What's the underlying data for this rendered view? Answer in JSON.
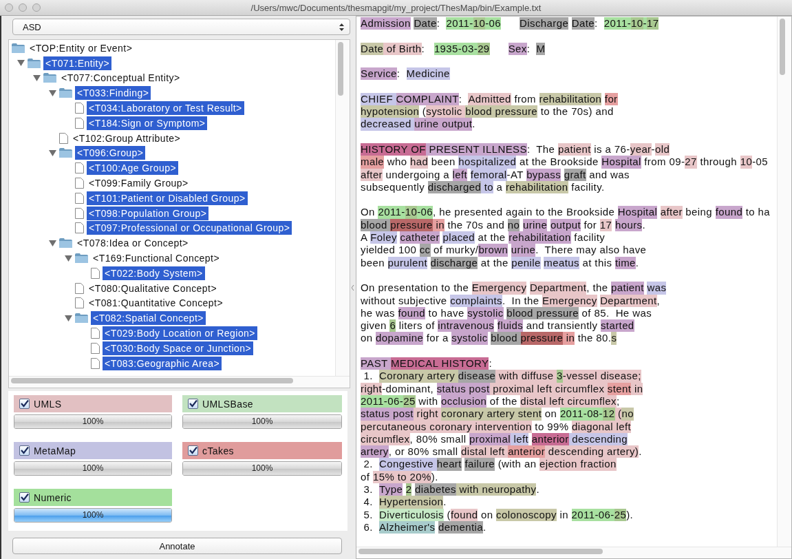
{
  "window": {
    "title": "/Users/mwc/Documents/thesmapgit/my_project/ThesMap/bin/Example.txt"
  },
  "left": {
    "dropdown": {
      "value": "ASD"
    },
    "tree": [
      {
        "label": "<TOP:Entity or Event>",
        "kind": "folder",
        "selected": false,
        "children": [
          {
            "label": "<T071:Entity>",
            "kind": "folder",
            "selected": true,
            "expanded": true,
            "children": [
              {
                "label": "<T077:Conceptual Entity>",
                "kind": "folder",
                "selected": false,
                "expanded": true,
                "children": [
                  {
                    "label": "<T033:Finding>",
                    "kind": "folder",
                    "selected": true,
                    "expanded": true,
                    "children": [
                      {
                        "label": "<T034:Laboratory or Test Result>",
                        "kind": "file",
                        "selected": true
                      },
                      {
                        "label": "<T184:Sign or Symptom>",
                        "kind": "file",
                        "selected": true
                      }
                    ]
                  },
                  {
                    "label": "<T102:Group Attribute>",
                    "kind": "file",
                    "selected": false
                  },
                  {
                    "label": "<T096:Group>",
                    "kind": "folder",
                    "selected": true,
                    "expanded": true,
                    "children": [
                      {
                        "label": "<T100:Age Group>",
                        "kind": "file",
                        "selected": true
                      },
                      {
                        "label": "<T099:Family Group>",
                        "kind": "file",
                        "selected": false
                      },
                      {
                        "label": "<T101:Patient or Disabled Group>",
                        "kind": "file",
                        "selected": true
                      },
                      {
                        "label": "<T098:Population Group>",
                        "kind": "file",
                        "selected": true
                      },
                      {
                        "label": "<T097:Professional or Occupational Group>",
                        "kind": "file",
                        "selected": true
                      }
                    ]
                  },
                  {
                    "label": "<T078:Idea or Concept>",
                    "kind": "folder",
                    "selected": false,
                    "expanded": true,
                    "children": [
                      {
                        "label": "<T169:Functional Concept>",
                        "kind": "folder",
                        "selected": false,
                        "expanded": true,
                        "children": [
                          {
                            "label": "<T022:Body System>",
                            "kind": "file",
                            "selected": true
                          }
                        ]
                      },
                      {
                        "label": "<T080:Qualitative Concept>",
                        "kind": "file",
                        "selected": false
                      },
                      {
                        "label": "<T081:Quantitative Concept>",
                        "kind": "file",
                        "selected": false
                      },
                      {
                        "label": "<T082:Spatial Concept>",
                        "kind": "folder",
                        "selected": true,
                        "expanded": true,
                        "children": [
                          {
                            "label": "<T029:Body Location or Region>",
                            "kind": "file",
                            "selected": true
                          },
                          {
                            "label": "<T030:Body Space or Junction>",
                            "kind": "file",
                            "selected": true
                          },
                          {
                            "label": "<T083:Geographic Area>",
                            "kind": "file",
                            "selected": true
                          }
                        ]
                      }
                    ]
                  }
                ]
              }
            ]
          }
        ]
      }
    ],
    "sources": [
      {
        "label": "UMLS",
        "checked": true,
        "color": "#e2c0c2",
        "level": 1,
        "reading": "100%",
        "active": false
      },
      {
        "label": "UMLSBase",
        "checked": true,
        "color": "#c2e2c0",
        "level": 1,
        "reading": "100%",
        "active": false
      },
      {
        "label": "MetaMap",
        "checked": true,
        "color": "#c2c2e2",
        "level": 1,
        "reading": "100%",
        "active": false
      },
      {
        "label": "cTakes",
        "checked": true,
        "color": "#e09c9c",
        "level": 1,
        "reading": "100%",
        "active": false
      },
      {
        "label": "Numeric",
        "checked": true,
        "color": "#a4e09c",
        "level": 1,
        "reading": "100%",
        "active": true
      }
    ],
    "annotate_button": "Annotate"
  },
  "document": {
    "paragraphs": [
      {
        "lines": [
          {
            "segments": [
              {
                "text": "Admission",
                "color": "#c8a6cc",
                "space_after": true
              },
              {
                "text": "Date",
                "color": "#a6a6a6"
              },
              {
                "text": ":  "
              },
              {
                "text": "2011-",
                "color": "#a8e0a0"
              },
              {
                "text": "10",
                "color": "#a8c890"
              },
              {
                "text": "-06",
                "color": "#a8e0a0",
                "tab_after": true
              },
              {
                "text": "Discharge",
                "color": "#a6a6a6",
                "space_after": true
              },
              {
                "text": "Date",
                "color": "#a6a6a6"
              },
              {
                "text": ":  "
              },
              {
                "text": "2011-",
                "color": "#a8e0a0"
              },
              {
                "text": "10",
                "color": "#a8c890"
              },
              {
                "text": "-",
                "color": "#a8e0a0"
              },
              {
                "text": "17",
                "color": "#a8c890"
              }
            ]
          }
        ]
      },
      {
        "lines": [
          {
            "segments": [
              {
                "text": "Date",
                "color": "#c8c8a8"
              },
              {
                "text": " of Birth",
                "color": "#e8c6c8"
              },
              {
                "text": ":   "
              },
              {
                "text": "1935-03-",
                "color": "#a8e0a0"
              },
              {
                "text": "29",
                "color": "#a8c890",
                "tab_after": true
              },
              {
                "text": "Sex",
                "color": "#c8a6cc"
              },
              {
                "text": ":  "
              },
              {
                "text": "M",
                "color": "#a6a6a6"
              }
            ]
          }
        ]
      },
      {
        "lines": [
          {
            "segments": [
              {
                "text": "Service",
                "color": "#c8a6cc"
              },
              {
                "text": ":  "
              },
              {
                "text": "Medicine",
                "color": "#c6c6e8"
              }
            ]
          }
        ]
      },
      {
        "lines": [
          {
            "segments": [
              {
                "text": "CHIEF ",
                "color": "#c6c6e8"
              },
              {
                "text": "COMPLAINT",
                "color": "#c8a6cc"
              },
              {
                "text": ":  "
              },
              {
                "text": "Admitted",
                "color": "#e8c6c8"
              },
              {
                "text": " from "
              },
              {
                "text": "rehabilitation",
                "color": "#c8c8a8",
                "space_after": true
              },
              {
                "text": "for",
                "color": "#e6a0a0"
              }
            ]
          },
          {
            "segments": [
              {
                "text": "hypotension",
                "color": "#c8c8a8"
              },
              {
                "text": " ("
              },
              {
                "text": "systolic ",
                "color": "#e8c6c8"
              },
              {
                "text": "blood pressure",
                "color": "#c8c8a8"
              },
              {
                "text": " to the 70s) and"
              }
            ]
          },
          {
            "segments": [
              {
                "text": "decreased ",
                "color": "#c6c6e8"
              },
              {
                "text": "urine output",
                "color": "#c8a6cc"
              },
              {
                "text": "."
              }
            ]
          }
        ]
      },
      {
        "lines": [
          {
            "segments": [
              {
                "text": "HISTORY OF",
                "color": "#c86c94"
              },
              {
                "text": " PRESENT ILLNESS",
                "color": "#c8a6cc"
              },
              {
                "text": ":  The "
              },
              {
                "text": "patient",
                "color": "#e8c6c8"
              },
              {
                "text": " is a 76-"
              },
              {
                "text": "year",
                "color": "#e8c6c8"
              },
              {
                "text": "-"
              },
              {
                "text": "old",
                "color": "#e8c6c8"
              }
            ]
          },
          {
            "segments": [
              {
                "text": "male",
                "color": "#e6a0a0"
              },
              {
                "text": " who "
              },
              {
                "text": "had",
                "color": "#e8c6c8"
              },
              {
                "text": " been "
              },
              {
                "text": "hospitalized",
                "color": "#c6c6e8"
              },
              {
                "text": " at the Brookside "
              },
              {
                "text": "Hospital",
                "color": "#c8a6cc"
              },
              {
                "text": " from 09-"
              },
              {
                "text": "27",
                "color": "#e8c6c8"
              },
              {
                "text": " through "
              },
              {
                "text": "10",
                "color": "#e8c6c8"
              },
              {
                "text": "-05"
              }
            ]
          },
          {
            "segments": [
              {
                "text": "after",
                "color": "#e8c6c8"
              },
              {
                "text": " undergoing a "
              },
              {
                "text": "left",
                "color": "#c8a6cc",
                "space_after": true
              },
              {
                "text": "femoral",
                "color": "#c6c6e8"
              },
              {
                "text": "-AT "
              },
              {
                "text": "bypass",
                "color": "#c8a6cc",
                "space_after": true
              },
              {
                "text": "graft",
                "color": "#a6a6a6"
              },
              {
                "text": " and was"
              }
            ]
          },
          {
            "segments": [
              {
                "text": "subsequently "
              },
              {
                "text": "discharged",
                "color": "#a6a6a6"
              },
              {
                "text": " to",
                "color": "#c6c6e8"
              },
              {
                "text": " a "
              },
              {
                "text": "rehabilitation",
                "color": "#c8c8a8"
              },
              {
                "text": " facility."
              }
            ]
          }
        ]
      },
      {
        "lines": [
          {
            "segments": [
              {
                "text": "On "
              },
              {
                "text": "2011-",
                "color": "#a8e0a0"
              },
              {
                "text": "10",
                "color": "#a8c890"
              },
              {
                "text": "-06",
                "color": "#a8e0a0"
              },
              {
                "text": ", he presented again to the Brookside "
              },
              {
                "text": "Hospital",
                "color": "#c8a6cc",
                "space_after": true
              },
              {
                "text": "after",
                "color": "#e8c6c8"
              },
              {
                "text": " being "
              },
              {
                "text": "found",
                "color": "#c8a6cc"
              },
              {
                "text": " to ha"
              }
            ]
          },
          {
            "segments": [
              {
                "text": "blood ",
                "color": "#a6a6a6"
              },
              {
                "text": "pressure",
                "color": "#b86868"
              },
              {
                "text": " in",
                "color": "#e6a0a0"
              },
              {
                "text": " the 70s and "
              },
              {
                "text": "no",
                "color": "#a6a6a6",
                "space_after": true
              },
              {
                "text": "urine",
                "color": "#c8a6cc",
                "space_after": true
              },
              {
                "text": "output",
                "color": "#c8a6cc"
              },
              {
                "text": " for "
              },
              {
                "text": "17",
                "color": "#e8c6c8",
                "space_after": true
              },
              {
                "text": "hours",
                "color": "#c8a6cc"
              },
              {
                "text": "."
              }
            ]
          },
          {
            "segments": [
              {
                "text": "A "
              },
              {
                "text": "Foley",
                "color": "#c6c6e8",
                "space_after": true
              },
              {
                "text": "catheter",
                "color": "#c8a6cc",
                "space_after": true
              },
              {
                "text": "placed",
                "color": "#c6c6e8"
              },
              {
                "text": " at the "
              },
              {
                "text": "rehabilitation",
                "color": "#c8a6cc"
              },
              {
                "text": " facility"
              }
            ]
          },
          {
            "segments": [
              {
                "text": "yielded 100 "
              },
              {
                "text": "cc",
                "color": "#a6a6a6"
              },
              {
                "text": " of murky/"
              },
              {
                "text": "brown",
                "color": "#c8a6cc",
                "space_after": true
              },
              {
                "text": "urine",
                "color": "#c8a6cc"
              },
              {
                "text": ".  There may also have"
              }
            ]
          },
          {
            "segments": [
              {
                "text": "been "
              },
              {
                "text": "purulent",
                "color": "#c6c6e8",
                "space_after": true
              },
              {
                "text": "discharge",
                "color": "#a6a6a6"
              },
              {
                "text": " at the "
              },
              {
                "text": "penile",
                "color": "#c6c6e8",
                "space_after": true
              },
              {
                "text": "meatus",
                "color": "#c6c6e8"
              },
              {
                "text": " at this "
              },
              {
                "text": "time",
                "color": "#c8a6cc"
              },
              {
                "text": "."
              }
            ]
          }
        ]
      },
      {
        "lines": [
          {
            "segments": [
              {
                "text": "On presentation to the "
              },
              {
                "text": "Emergency",
                "color": "#e8c6c8",
                "space_after": true
              },
              {
                "text": "Department",
                "color": "#e8c6c8"
              },
              {
                "text": ", the "
              },
              {
                "text": "patient",
                "color": "#c8a6cc",
                "space_after": true
              },
              {
                "text": "was",
                "color": "#c6c6e8"
              }
            ]
          },
          {
            "segments": [
              {
                "text": "without subjective "
              },
              {
                "text": "complaints",
                "color": "#c6c6e8"
              },
              {
                "text": ".  In the "
              },
              {
                "text": "Emergency",
                "color": "#e8c6c8",
                "space_after": true
              },
              {
                "text": "Department",
                "color": "#e8c6c8"
              },
              {
                "text": ","
              }
            ]
          },
          {
            "segments": [
              {
                "text": "he was "
              },
              {
                "text": "found",
                "color": "#c8a6cc"
              },
              {
                "text": " to have "
              },
              {
                "text": "systolic",
                "color": "#c8a6cc",
                "space_after": true
              },
              {
                "text": "blood pressure",
                "color": "#a6a6a6"
              },
              {
                "text": " of 85.  He was"
              }
            ]
          },
          {
            "segments": [
              {
                "text": "given "
              },
              {
                "text": "6",
                "color": "#a8c890"
              },
              {
                "text": " liters of "
              },
              {
                "text": "intravenous",
                "color": "#c8a6cc",
                "space_after": true
              },
              {
                "text": "fluids",
                "color": "#c8a6cc"
              },
              {
                "text": " and transiently "
              },
              {
                "text": "started",
                "color": "#c8a6cc"
              }
            ]
          },
          {
            "segments": [
              {
                "text": "on "
              },
              {
                "text": "dopamine",
                "color": "#c8a6cc"
              },
              {
                "text": " for a "
              },
              {
                "text": "systolic",
                "color": "#c8a6cc",
                "space_after": true
              },
              {
                "text": "blood ",
                "color": "#a6a6a6"
              },
              {
                "text": "pressure",
                "color": "#b86868"
              },
              {
                "text": " in",
                "color": "#e6a0a0"
              },
              {
                "text": " the 80."
              },
              {
                "text": "s",
                "color": "#c8c8a8"
              }
            ]
          }
        ]
      },
      {
        "lines": [
          {
            "segments": [
              {
                "text": "PAST ",
                "color": "#c8a6cc"
              },
              {
                "text": "MEDICAL HISTORY",
                "color": "#c86c94"
              },
              {
                "text": ":"
              }
            ]
          },
          {
            "segments": [
              {
                "text": " 1.  "
              },
              {
                "text": "Coronary artery ",
                "color": "#c8c8a8"
              },
              {
                "text": "disease",
                "color": "#a6a6a6"
              },
              {
                "text": " with diffuse ",
                "color": "#e8c6c8"
              },
              {
                "text": "3",
                "color": "#a8c890"
              },
              {
                "text": "-vessel disease;",
                "color": "#e8c6c8"
              }
            ]
          },
          {
            "segments": [
              {
                "text": "right",
                "color": "#e8c6c8"
              },
              {
                "text": "-dominant, "
              },
              {
                "text": "status post",
                "color": "#c8a6cc"
              },
              {
                "text": " proximal left circumflex ",
                "color": "#e8c6c8"
              },
              {
                "text": "stent",
                "color": "#e6a0a0"
              },
              {
                "text": " in",
                "color": "#e8c6c8"
              }
            ]
          },
          {
            "segments": [
              {
                "text": "2011-06-",
                "color": "#a8e0a0"
              },
              {
                "text": "25",
                "color": "#a8c890"
              },
              {
                "text": " with "
              },
              {
                "text": "occlusion",
                "color": "#c8a6cc"
              },
              {
                "text": " of the "
              },
              {
                "text": "distal left circumflex",
                "color": "#e8c6c8"
              },
              {
                "text": ";"
              }
            ]
          },
          {
            "segments": [
              {
                "text": "status post",
                "color": "#c8a6cc"
              },
              {
                "text": " right ",
                "color": "#e8c6c8"
              },
              {
                "text": "coronary artery stent",
                "color": "#c8c8a8"
              },
              {
                "text": " on "
              },
              {
                "text": "2011-08-",
                "color": "#a8e0a0"
              },
              {
                "text": "12",
                "color": "#a8c890"
              },
              {
                "text": " (",
                "color": "#e8c6c8"
              },
              {
                "text": "no",
                "color": "#c8c8a8"
              }
            ]
          },
          {
            "segments": [
              {
                "text": "percutaneous coronary intervention",
                "color": "#e8c6c8"
              },
              {
                "text": " to 99% "
              },
              {
                "text": "diagonal left",
                "color": "#e8c6c8"
              }
            ]
          },
          {
            "segments": [
              {
                "text": "circumflex",
                "color": "#e8c6c8"
              },
              {
                "text": ", 80% small "
              },
              {
                "text": "proximal",
                "color": "#c8a6cc"
              },
              {
                "text": " left",
                "color": "#c6c6e8",
                "space_after": true
              },
              {
                "text": "anterior",
                "color": "#c86c94"
              },
              {
                "text": " descending",
                "color": "#c6c6e8"
              }
            ]
          },
          {
            "segments": [
              {
                "text": "artery",
                "color": "#c8a6cc"
              },
              {
                "text": ", or 80% small "
              },
              {
                "text": "distal left ",
                "color": "#e8c6c8"
              },
              {
                "text": "anterior",
                "color": "#e6a0a0"
              },
              {
                "text": " descending artery)",
                "color": "#e8c6c8"
              },
              {
                "text": "."
              }
            ]
          },
          {
            "segments": [
              {
                "text": " 2.  "
              },
              {
                "text": "Congestive ",
                "color": "#c6c6e8"
              },
              {
                "text": "heart",
                "color": "#a6a6a6",
                "space_after": true
              },
              {
                "text": "failure",
                "color": "#a6a6a6"
              },
              {
                "text": " (with an "
              },
              {
                "text": "ejection fraction",
                "color": "#e8c6c8"
              }
            ]
          },
          {
            "segments": [
              {
                "text": "of "
              },
              {
                "text": "15% to 20%",
                "color": "#e8c6c8"
              },
              {
                "text": ")."
              }
            ]
          },
          {
            "segments": [
              {
                "text": " 3.  "
              },
              {
                "text": "Type",
                "color": "#c8a6cc",
                "space_after": true
              },
              {
                "text": "2",
                "color": "#a8c890",
                "space_after": true
              },
              {
                "text": "diabetes",
                "color": "#a6a6a6"
              },
              {
                "text": " with neuropathy",
                "color": "#c8c8a8"
              },
              {
                "text": "."
              }
            ]
          },
          {
            "segments": [
              {
                "text": " 4.  "
              },
              {
                "text": "Hypertension",
                "color": "#c8c8a8"
              },
              {
                "text": "."
              }
            ]
          },
          {
            "segments": [
              {
                "text": " 5.  "
              },
              {
                "text": "Diverticulosis",
                "color": "#c6eac6"
              },
              {
                "text": " ("
              },
              {
                "text": "found",
                "color": "#e8c6c8"
              },
              {
                "text": " on "
              },
              {
                "text": "colonoscopy",
                "color": "#c8c8a8"
              },
              {
                "text": " in "
              },
              {
                "text": "2011-06-",
                "color": "#a8e0a0"
              },
              {
                "text": "25",
                "color": "#a8c890"
              },
              {
                "text": ")."
              }
            ]
          },
          {
            "segments": [
              {
                "text": " 6.  "
              },
              {
                "text": "Alzheimer's",
                "color": "#a8cccc",
                "space_after": true
              },
              {
                "text": "dementia",
                "color": "#a6a6a6"
              },
              {
                "text": "."
              }
            ]
          }
        ]
      }
    ]
  }
}
